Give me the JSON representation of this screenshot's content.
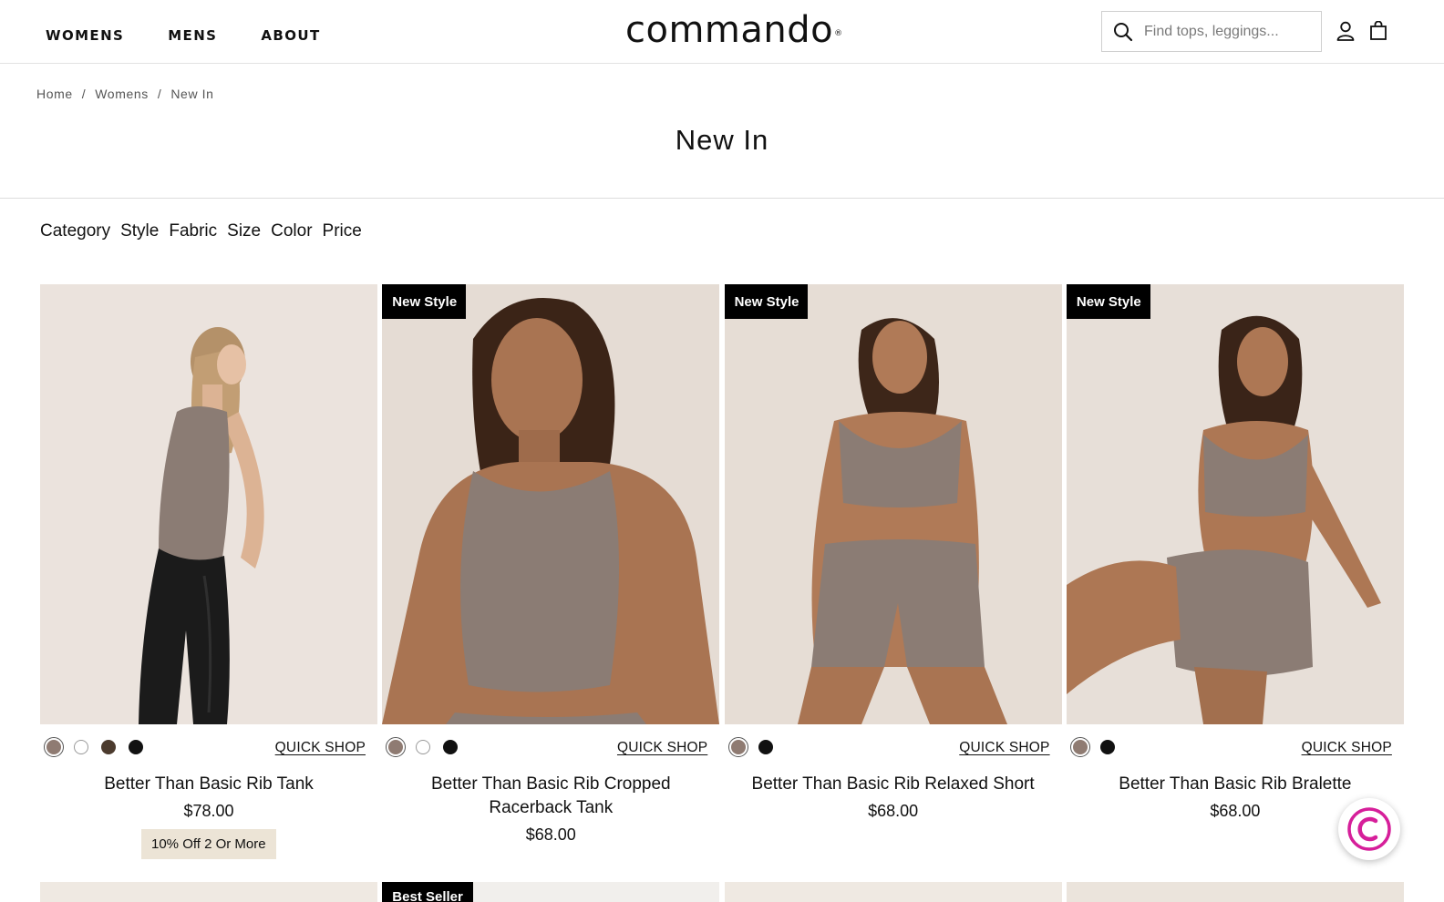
{
  "header": {
    "nav": [
      {
        "label": "WOMENS"
      },
      {
        "label": "MENS"
      },
      {
        "label": "ABOUT"
      }
    ],
    "logo": "commando",
    "logo_mark": "®",
    "search_placeholder": "Find tops, leggings..."
  },
  "breadcrumb": {
    "items": [
      "Home",
      "Womens",
      "New In"
    ],
    "separator": "/"
  },
  "page_title": "New In",
  "filters": [
    "Category",
    "Style",
    "Fabric",
    "Size",
    "Color",
    "Price"
  ],
  "products": [
    {
      "name": "Better Than Basic Rib Tank",
      "price": "$78.00",
      "badge": "",
      "promo": "10% Off 2 Or More",
      "quick_shop": "QUICK SHOP",
      "swatches": [
        "#8f7b72",
        "#ffffff",
        "#4c3b2e",
        "#111111"
      ],
      "selected_swatch": 0
    },
    {
      "name": "Better Than Basic Rib Cropped Racerback Tank",
      "price": "$68.00",
      "badge": "New Style",
      "promo": "",
      "quick_shop": "QUICK SHOP",
      "swatches": [
        "#8f7b72",
        "#ffffff",
        "#111111"
      ],
      "selected_swatch": 0
    },
    {
      "name": "Better Than Basic Rib Relaxed Short",
      "price": "$68.00",
      "badge": "New Style",
      "promo": "",
      "quick_shop": "QUICK SHOP",
      "swatches": [
        "#8f7b72",
        "#111111"
      ],
      "selected_swatch": 0
    },
    {
      "name": "Better Than Basic Rib Bralette",
      "price": "$68.00",
      "badge": "New Style",
      "promo": "",
      "quick_shop": "QUICK SHOP",
      "swatches": [
        "#8f7b72",
        "#111111"
      ],
      "selected_swatch": 0
    }
  ],
  "next_row_badge": "Best Seller",
  "colors": {
    "photo_bg": "#e6dfd8",
    "garment": "#8b7c74",
    "promo_bg": "#ece4d6",
    "chat_accent": "#d61f9a"
  }
}
